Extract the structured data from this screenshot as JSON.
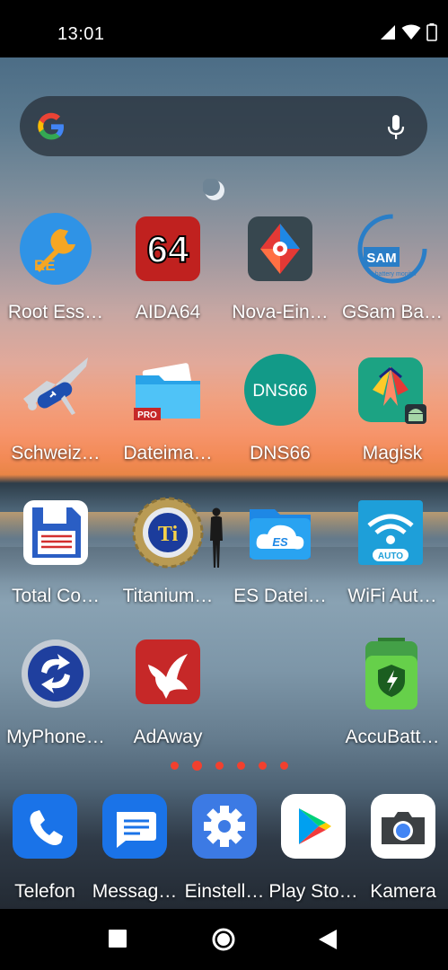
{
  "status": {
    "time": "13:01"
  },
  "search": {
    "hint": ""
  },
  "apps": [
    {
      "label": "Root Ess…",
      "icon": "root-essentials-icon"
    },
    {
      "label": "AIDA64",
      "icon": "aida64-icon",
      "badge": "64"
    },
    {
      "label": "Nova-Ein…",
      "icon": "nova-settings-icon"
    },
    {
      "label": "GSam Ba…",
      "icon": "gsam-battery-icon",
      "badge": "SAM",
      "sub": "battery monitor"
    },
    {
      "label": "Schweiz…",
      "icon": "swiss-knife-icon"
    },
    {
      "label": "Dateima…",
      "icon": "file-manager-icon",
      "badge": "PRO"
    },
    {
      "label": "DNS66",
      "icon": "dns66-icon",
      "badge": "DNS66"
    },
    {
      "label": "Magisk",
      "icon": "magisk-icon"
    },
    {
      "label": "Total Co…",
      "icon": "total-commander-icon"
    },
    {
      "label": "Titanium…",
      "icon": "titanium-backup-icon",
      "badge": "Ti"
    },
    {
      "label": "ES Datei…",
      "icon": "es-file-explorer-icon",
      "badge": "ES"
    },
    {
      "label": "WiFi Aut…",
      "icon": "wifi-auto-icon",
      "badge": "AUTO"
    },
    {
      "label": "MyPhone…",
      "icon": "myphoneexplorer-icon"
    },
    {
      "label": "AdAway",
      "icon": "adaway-icon"
    },
    {
      "label": "AccuBatt…",
      "icon": "accubattery-icon"
    }
  ],
  "dock": [
    {
      "label": "Telefon",
      "icon": "phone-icon"
    },
    {
      "label": "Messag…",
      "icon": "messages-icon"
    },
    {
      "label": "Einstell…",
      "icon": "settings-icon"
    },
    {
      "label": "Play Sto…",
      "icon": "play-store-icon"
    },
    {
      "label": "Kamera",
      "icon": "camera-icon"
    }
  ],
  "pages": {
    "count": 6,
    "active": 1
  },
  "colors": {
    "accent_dots": "#f2402e"
  }
}
